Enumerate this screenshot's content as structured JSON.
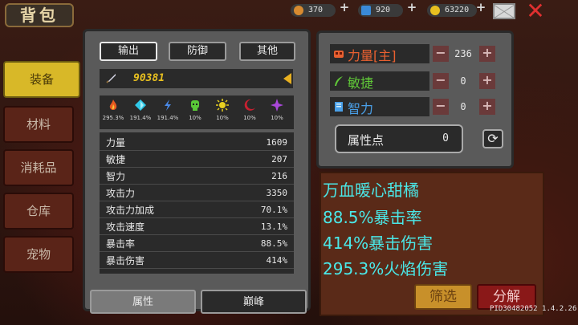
{
  "header": {
    "title": "背包",
    "currencies": [
      {
        "icon": "meat-icon",
        "value": "370",
        "color": "#d88a30"
      },
      {
        "icon": "gem-icon",
        "value": "920",
        "color": "#3a8ad8"
      },
      {
        "icon": "coin-icon",
        "value": "63220",
        "color": "#e8c020"
      }
    ]
  },
  "sidebar": {
    "items": [
      {
        "label": "装备",
        "active": true
      },
      {
        "label": "材料",
        "active": false
      },
      {
        "label": "消耗品",
        "active": false
      },
      {
        "label": "仓库",
        "active": false
      },
      {
        "label": "宠物",
        "active": false
      }
    ]
  },
  "equip_panel": {
    "tabs": [
      {
        "label": "输出",
        "active": true
      },
      {
        "label": "防御",
        "active": false
      },
      {
        "label": "其他",
        "active": false
      }
    ],
    "power": "90381",
    "elements": [
      {
        "icon": "fire-icon",
        "value": "295.3%",
        "color": "#e85a20"
      },
      {
        "icon": "ice-crystal-icon",
        "value": "191.4%",
        "color": "#30c8e8"
      },
      {
        "icon": "lightning-icon",
        "value": "191.4%",
        "color": "#4a8ae8"
      },
      {
        "icon": "poison-skull-icon",
        "value": "10%",
        "color": "#5ac838"
      },
      {
        "icon": "sun-icon",
        "value": "10%",
        "color": "#e8d020"
      },
      {
        "icon": "moon-icon",
        "value": "10%",
        "color": "#c82030"
      },
      {
        "icon": "void-star-icon",
        "value": "10%",
        "color": "#a848d8"
      }
    ],
    "stats": [
      {
        "label": "力量",
        "value": "1609"
      },
      {
        "label": "敏捷",
        "value": "207"
      },
      {
        "label": "智力",
        "value": "216"
      },
      {
        "label": "攻击力",
        "value": "3350"
      },
      {
        "label": "攻击力加成",
        "value": "70.1%"
      },
      {
        "label": "攻击速度",
        "value": "13.1%"
      },
      {
        "label": "暴击率",
        "value": "88.5%"
      },
      {
        "label": "暴击伤害",
        "value": "414%"
      }
    ],
    "bottom_tabs": [
      {
        "label": "属性",
        "active": true
      },
      {
        "label": "巅峰",
        "active": false
      }
    ]
  },
  "attributes": {
    "rows": [
      {
        "label": "力量[主]",
        "value": "236",
        "color": "#e86030",
        "icon": "fist-icon"
      },
      {
        "label": "敏捷",
        "value": "0",
        "color": "#60c838",
        "icon": "feather-icon"
      },
      {
        "label": "智力",
        "value": "0",
        "color": "#4aa0e8",
        "icon": "book-icon"
      }
    ],
    "points_label": "属性点",
    "points_value": "0"
  },
  "overlay_lines": [
    "万血暖心甜橘",
    "88.5%暴击率",
    "414%暴击伤害",
    "295.3%火焰伤害"
  ],
  "buttons": {
    "filter": "筛选",
    "decompose": "分解"
  },
  "version": "PID30482052 1.4.2.26"
}
